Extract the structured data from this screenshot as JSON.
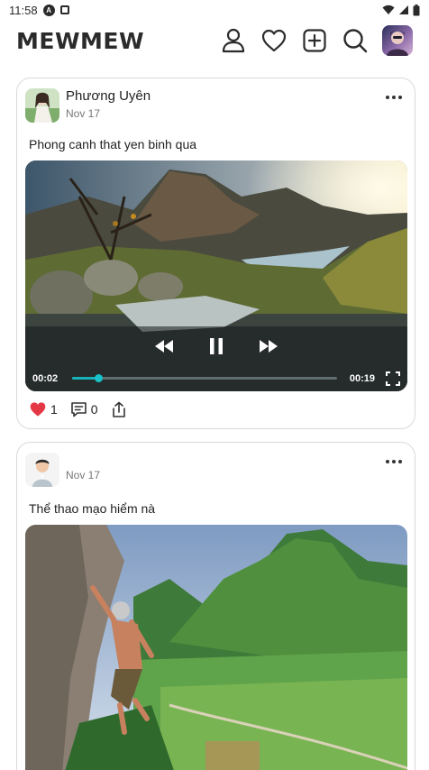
{
  "status_bar": {
    "time": "11:58",
    "icons": [
      "notification-a-icon",
      "notification-square-icon",
      "wifi-icon",
      "signal-icon",
      "battery-icon"
    ]
  },
  "app_bar": {
    "title": "MEWMEW",
    "actions": [
      "profile-icon",
      "heart-icon",
      "add-post-icon",
      "search-icon",
      "user-avatar"
    ]
  },
  "posts": [
    {
      "author": "Phương Uyên",
      "date": "Nov 17",
      "caption": "Phong canh that yen binh qua",
      "media_type": "video",
      "video": {
        "elapsed": "00:02",
        "duration": "00:19",
        "progress": 0.1
      },
      "likes": "1",
      "comments": "0",
      "liked": true
    },
    {
      "author": "",
      "date": "Nov 17",
      "caption": "Thể thao mạo hiểm nà",
      "media_type": "image"
    }
  ],
  "colors": {
    "accent": "#17b2b8",
    "like": "#e53845",
    "text": "#222222",
    "muted": "#777777",
    "border": "#dadada"
  }
}
